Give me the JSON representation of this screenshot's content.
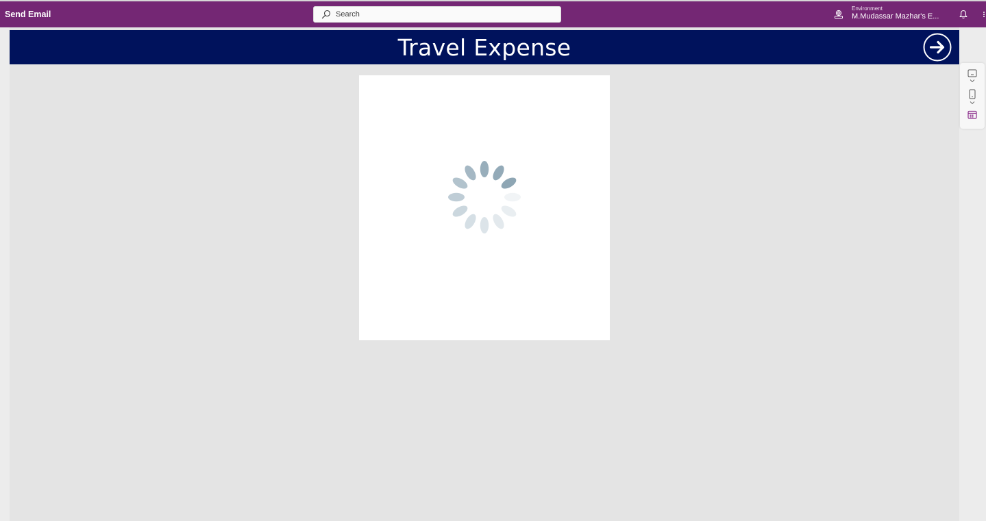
{
  "header": {
    "app_title": "Send Email",
    "search": {
      "placeholder": "Search",
      "value": ""
    },
    "environment": {
      "label": "Environment",
      "value": "M.Mudassar Mazhar's E..."
    },
    "icons": [
      "search-icon",
      "environment-icon",
      "bell-icon",
      "more-icon"
    ],
    "color": "#742774"
  },
  "canvas": {
    "title": "Travel Expense",
    "header_color": "#00125c",
    "next_button_icon": "arrow-right-circle-icon",
    "loading": {
      "icon": "spinner-icon"
    }
  },
  "side_toolbar": {
    "icons": [
      "tablet-layout-icon",
      "chevron-down-icon",
      "phone-layout-icon",
      "chevron-down-icon",
      "calendar-icon"
    ]
  }
}
